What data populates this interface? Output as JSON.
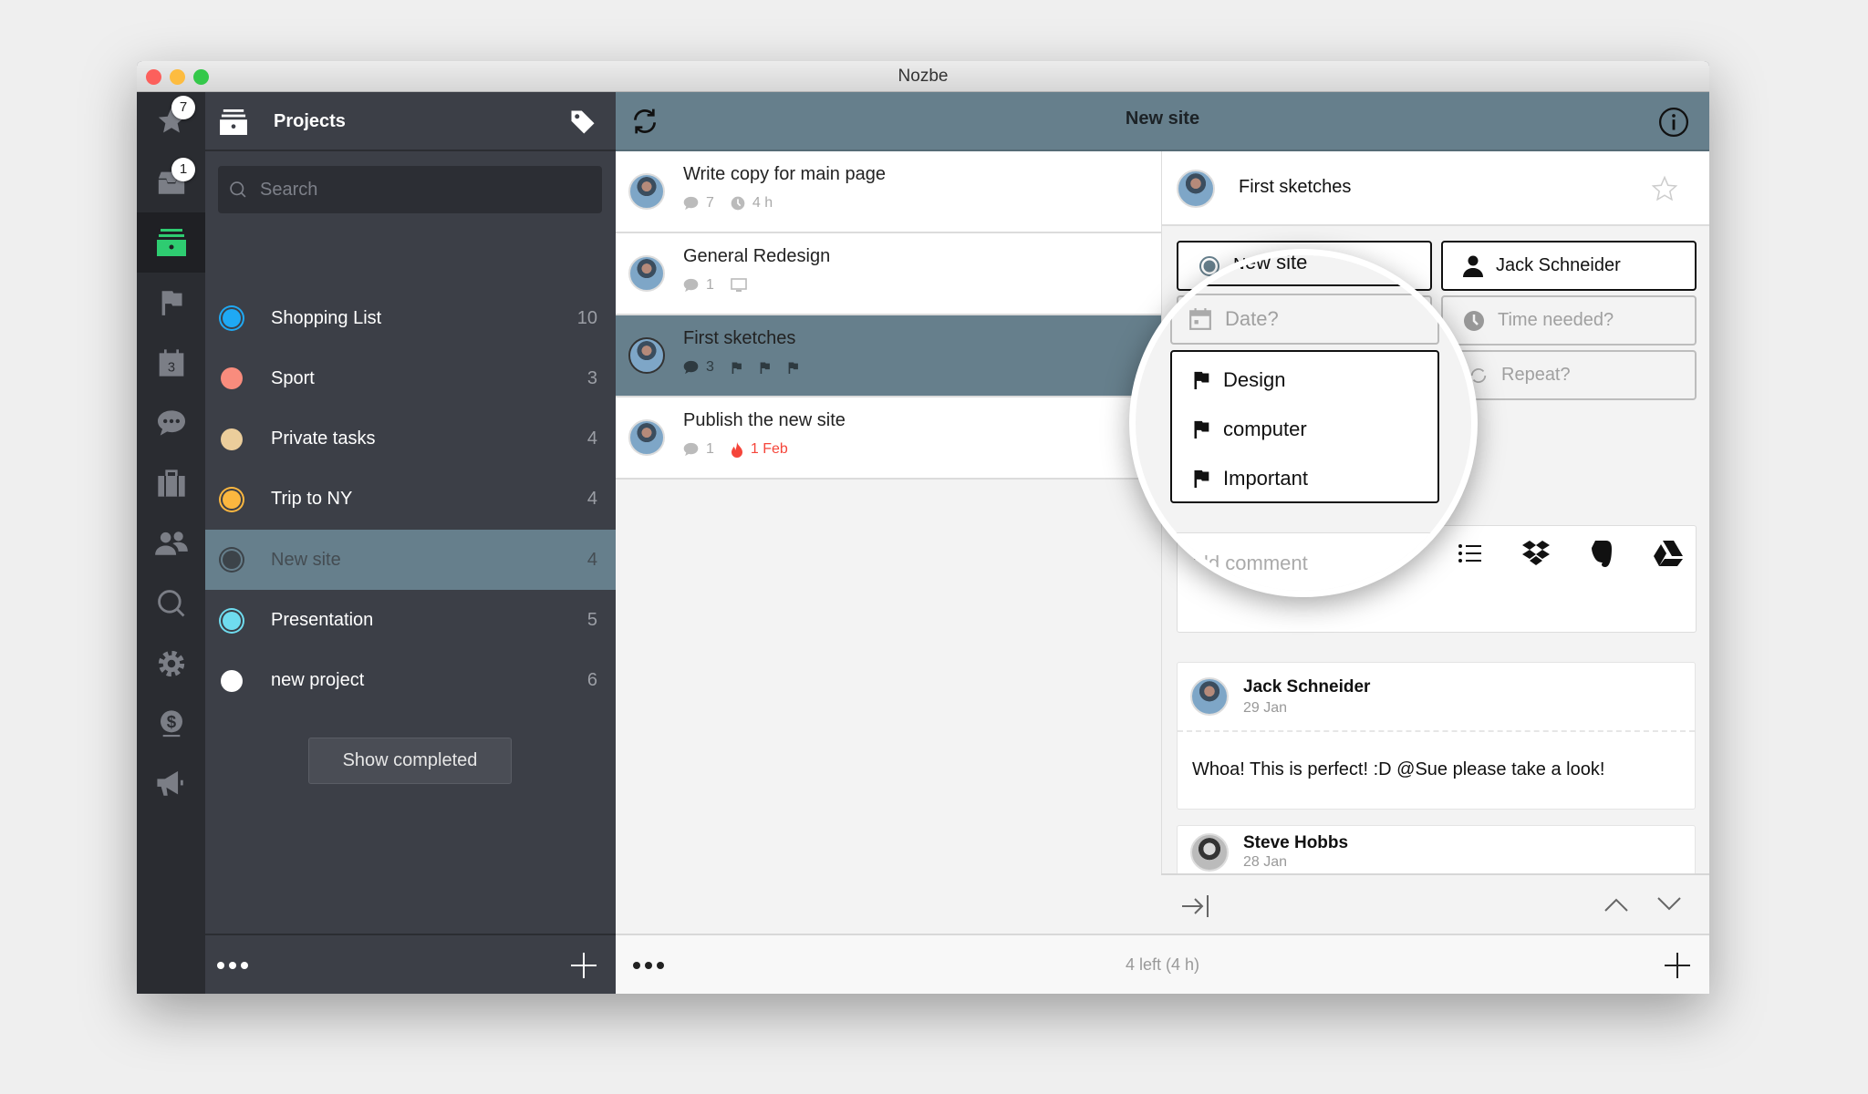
{
  "window": {
    "title": "Nozbe"
  },
  "rail": {
    "items": [
      {
        "icon": "star-icon",
        "badge": "7"
      },
      {
        "icon": "inbox-icon",
        "badge": "1"
      },
      {
        "icon": "projects-icon",
        "active": true
      },
      {
        "icon": "flag-icon"
      },
      {
        "icon": "calendar-icon",
        "text": "3"
      },
      {
        "icon": "comments-icon"
      },
      {
        "icon": "briefcase-icon"
      },
      {
        "icon": "team-icon"
      },
      {
        "icon": "search-icon"
      },
      {
        "icon": "settings-icon"
      },
      {
        "icon": "billing-icon"
      },
      {
        "icon": "megaphone-icon"
      }
    ]
  },
  "projects": {
    "title": "Projects",
    "search_placeholder": "Search",
    "items": [
      {
        "name": "Shopping List",
        "count": "10",
        "color": "#1fa9f4",
        "ring": true
      },
      {
        "name": "Sport",
        "count": "3",
        "color": "#f98c7d"
      },
      {
        "name": "Private tasks",
        "count": "4",
        "color": "#ebcd9b"
      },
      {
        "name": "Trip to NY",
        "count": "4",
        "color": "#fbb73f",
        "ring": true
      },
      {
        "name": "New site",
        "count": "4",
        "color": "#3c4349",
        "ring": true,
        "selected": true
      },
      {
        "name": "Presentation",
        "count": "5",
        "color": "#6fdcef",
        "ring": true
      },
      {
        "name": "new project",
        "count": "6",
        "color": "#ffffff"
      }
    ],
    "show_completed": "Show completed"
  },
  "header": {
    "title": "New site"
  },
  "tasks": [
    {
      "title": "Write copy for main page",
      "comments": "7",
      "time": "4 h"
    },
    {
      "title": "General Redesign",
      "comments": "1",
      "extra_icon": "monitor-icon"
    },
    {
      "title": "First sketches",
      "comments": "3",
      "flags": 3,
      "selected": true
    },
    {
      "title": "Publish the new site",
      "comments": "1",
      "due": "1 Feb",
      "due_color": "#f5453a"
    }
  ],
  "footer": {
    "status": "4 left (4 h)"
  },
  "detail": {
    "title": "First sketches",
    "project": "New site",
    "responsible": "Jack Schneider",
    "date_placeholder": "Date?",
    "time_placeholder": "Time needed?",
    "repeat_placeholder": "Repeat?",
    "categories": [
      "Design",
      "computer",
      "Important"
    ],
    "comment_placeholder": "Add comment",
    "comments": [
      {
        "author": "Jack Schneider",
        "date": "29 Jan",
        "text": "Whoa! This is perfect! :D @Sue please take a look!"
      },
      {
        "author": "Steve Hobbs",
        "date": "28 Jan"
      }
    ]
  },
  "colors": {
    "accent": "#667f8c",
    "sidebar": "#3c3f47",
    "rail": "#2a2c31",
    "active_green": "#2ecc71"
  }
}
